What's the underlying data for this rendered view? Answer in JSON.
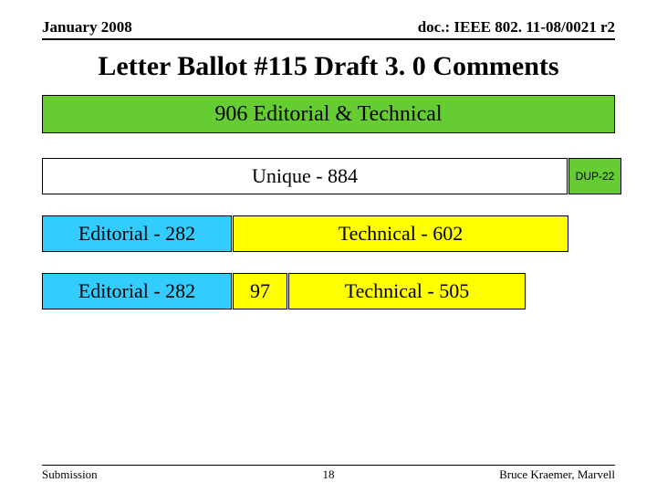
{
  "header": {
    "date": "January 2008",
    "doc": "doc.: IEEE 802. 11-08/0021 r2"
  },
  "title": "Letter Ballot #115  Draft 3. 0 Comments",
  "boxes": {
    "total": "906 Editorial & Technical",
    "unique": "Unique - 884",
    "dup": "DUP-22",
    "editorial_row1": "Editorial - 282",
    "technical_row1": "Technical - 602",
    "editorial_row2": "Editorial - 282",
    "mid97": "97",
    "technical_row2": "Technical - 505"
  },
  "footer": {
    "left": "Submission",
    "center": "18",
    "right": "Bruce Kraemer, Marvell"
  },
  "chart_data": {
    "type": "table",
    "title": "Letter Ballot #115 Draft 3.0 Comments breakdown",
    "total_comments": 906,
    "unique_comments": 884,
    "duplicate_comments": 22,
    "breakdown_rows": [
      {
        "editorial": 282,
        "technical": 602
      },
      {
        "editorial": 282,
        "middle": 97,
        "technical": 505
      }
    ]
  }
}
